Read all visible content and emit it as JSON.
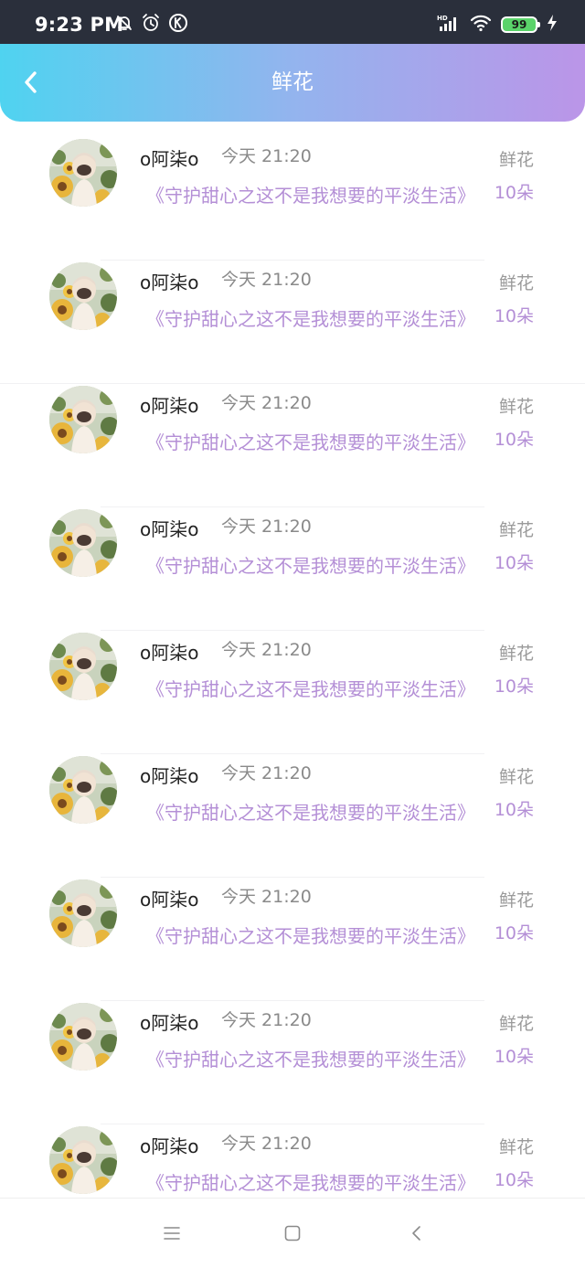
{
  "status_bar": {
    "time": "9:23 PM",
    "icons_left": [
      "bell-off-icon",
      "alarm-icon",
      "k-app-icon"
    ],
    "icons_right": [
      "hd-signal-icon",
      "wifi-icon",
      "battery-icon",
      "charging-icon"
    ],
    "battery_level": "99"
  },
  "header": {
    "title": "鲜花",
    "back_icon": "chevron-left-icon",
    "gradient": [
      "#4fd3f0",
      "#bb95e8"
    ]
  },
  "list": {
    "items": [
      {
        "user": "o阿柒o",
        "time": "今天 21:20",
        "book": "《守护甜心之这不是我想要的平淡生活》",
        "gift": "鲜花",
        "count": "10朵"
      },
      {
        "user": "o阿柒o",
        "time": "今天 21:20",
        "book": "《守护甜心之这不是我想要的平淡生活》",
        "gift": "鲜花",
        "count": "10朵"
      },
      {
        "user": "o阿柒o",
        "time": "今天 21:20",
        "book": "《守护甜心之这不是我想要的平淡生活》",
        "gift": "鲜花",
        "count": "10朵"
      },
      {
        "user": "o阿柒o",
        "time": "今天 21:20",
        "book": "《守护甜心之这不是我想要的平淡生活》",
        "gift": "鲜花",
        "count": "10朵"
      },
      {
        "user": "o阿柒o",
        "time": "今天 21:20",
        "book": "《守护甜心之这不是我想要的平淡生活》",
        "gift": "鲜花",
        "count": "10朵"
      },
      {
        "user": "o阿柒o",
        "time": "今天 21:20",
        "book": "《守护甜心之这不是我想要的平淡生活》",
        "gift": "鲜花",
        "count": "10朵"
      },
      {
        "user": "o阿柒o",
        "time": "今天 21:20",
        "book": "《守护甜心之这不是我想要的平淡生活》",
        "gift": "鲜花",
        "count": "10朵"
      },
      {
        "user": "o阿柒o",
        "time": "今天 21:20",
        "book": "《守护甜心之这不是我想要的平淡生活》",
        "gift": "鲜花",
        "count": "10朵"
      },
      {
        "user": "o阿柒o",
        "time": "今天 21:20",
        "book": "《守护甜心之这不是我想要的平淡生活》",
        "gift": "鲜花",
        "count": "10朵"
      }
    ]
  },
  "nav_bar": {
    "icons": [
      "menu-icon",
      "home-icon",
      "back-icon"
    ]
  },
  "colors": {
    "accent_purple": "#b48fd6",
    "status_bar_bg": "#2a2f3b"
  }
}
